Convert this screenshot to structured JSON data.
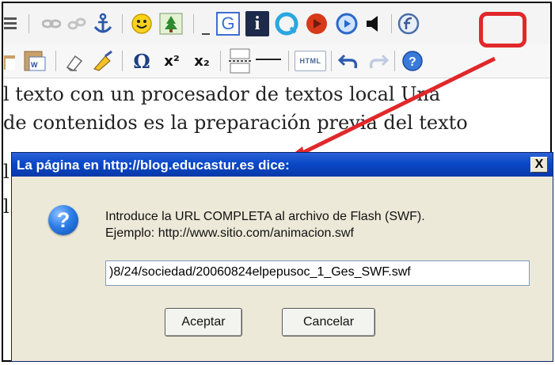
{
  "editor": {
    "line1": "l texto con un procesador de textos local Una",
    "line2": "de contenidos es la preparación previa del texto",
    "line3": "l",
    "line4": "l"
  },
  "toolbar2": {
    "html_label": "HTML",
    "omega": "Ω",
    "superscript": "x²",
    "subscript": "x₂",
    "g_letter": "G",
    "info_letter": "i"
  },
  "dialog": {
    "title": "La página en http://blog.educastur.es dice:",
    "close": "X",
    "message_line1": "Introduce la URL COMPLETA al archivo de Flash (SWF).",
    "message_line2": "Ejemplo: http://www.sitio.com/animacion.swf",
    "input_value": ")8/24/sociedad/20060824elpepusoc_1_Ges_SWF.swf",
    "ok_label": "Aceptar",
    "cancel_label": "Cancelar"
  },
  "colors": {
    "highlight": "#e0282a",
    "titlebar": "#0a48c8",
    "dialog_bg": "#ece9d8"
  },
  "icons": [
    "list-icon",
    "link-icon",
    "unlink-icon",
    "anchor-icon",
    "smiley-icon",
    "image-icon",
    "google-icon",
    "info-icon",
    "quicktime-icon",
    "realplayer-icon",
    "windows-media-icon",
    "sound-icon",
    "flash-icon",
    "paste-icon",
    "paste-word-icon",
    "eraser-icon",
    "cleanup-icon",
    "omega-icon",
    "superscript-icon",
    "subscript-icon",
    "page-break-icon",
    "horizontal-rule-icon",
    "html-icon",
    "undo-icon",
    "redo-icon",
    "help-icon",
    "question-icon"
  ]
}
